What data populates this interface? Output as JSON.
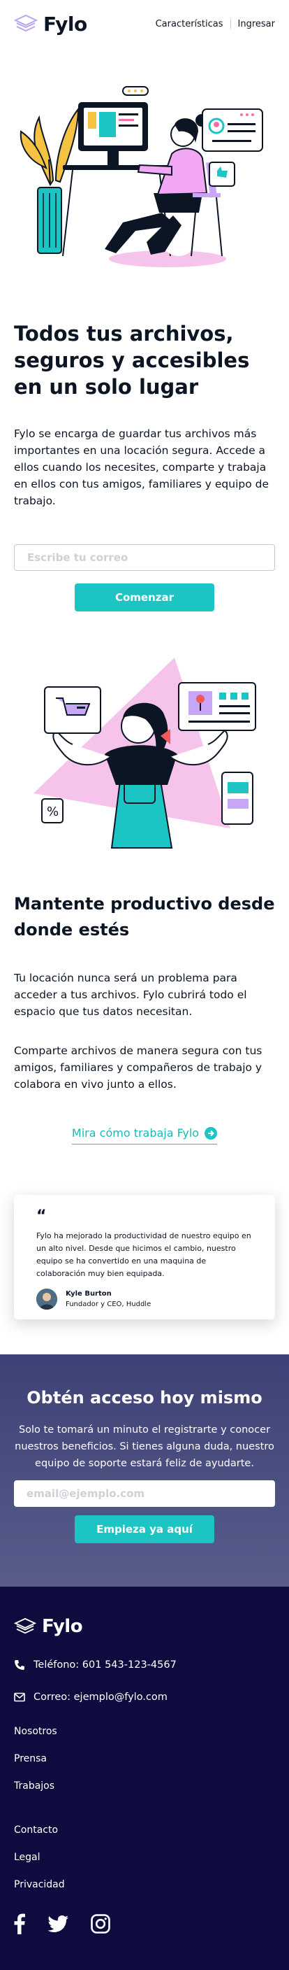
{
  "brand": {
    "name": "Fylo",
    "accent": "#1cc4c4",
    "dark": "#0e0c3e"
  },
  "nav": {
    "features": "Características",
    "login": "Ingresar"
  },
  "hero": {
    "title": "Todos tus archivos, seguros y accesibles en un solo lugar",
    "description": "Fylo se encarga de guardar tus archivos más importantes en una locación segura. Accede a ellos cuando los necesites, comparte y trabaja en ellos con tus amigos, familiares y equipo de trabajo.",
    "email_placeholder": "Escribe tu correo",
    "button": "Comenzar"
  },
  "productive": {
    "title": "Mantente productivo desde donde estés",
    "p1": "Tu locación nunca será un problema para acceder a tus archivos. Fylo cubrirá todo el espacio que tus datos necesitan.",
    "p2": "Comparte archivos de manera segura con tus amigos, familiares y compañeros de trabajo y colabora en vivo junto a ellos.",
    "link": "Mira cómo trabaja Fylo"
  },
  "testimonial": {
    "quote_mark": "“",
    "text": "Fylo ha mejorado la productividad de nuestro equipo en un alto nivel. Desde que hicimos el cambio, nuestro equipo se ha convertido en una maquina de colaboración muy bien equipada.",
    "name": "Kyle Burton",
    "role": "Fundador y CEO, Huddle"
  },
  "cta": {
    "title": "Obtén acceso hoy mismo",
    "text": "Solo te tomará un minuto el registrarte y conocer nuestros beneficios. Si tienes alguna duda, nuestro equipo de soporte estará feliz de ayudarte.",
    "email_placeholder": "email@ejemplo.com",
    "button": "Empieza ya aquí"
  },
  "footer": {
    "phone": "Teléfono: 601 543-123-4567",
    "email": "Correo: ejemplo@fylo.com",
    "links1": [
      "Nosotros",
      "Prensa",
      "Trabajos"
    ],
    "links2": [
      "Contacto",
      "Legal",
      "Privacidad"
    ],
    "social": [
      "facebook-icon",
      "twitter-icon",
      "instagram-icon"
    ]
  }
}
